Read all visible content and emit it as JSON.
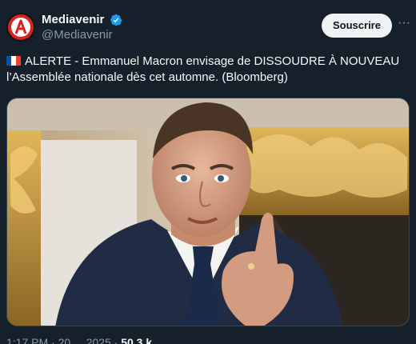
{
  "author": {
    "display_name": "Mediavenir",
    "handle": "@Mediavenir",
    "verified": true
  },
  "actions": {
    "subscribe_label": "Souscrire",
    "more_label": "···"
  },
  "tweet": {
    "flag_icon": "france-flag-icon",
    "text": "ALERTE - Emmanuel Macron envisage de DISSOUDRE À NOUVEAU l’Assemblée nationale dès cet automne. (Bloomberg)"
  },
  "media": {
    "image_icon": "photo-of-man-gesturing-icon"
  },
  "footer": {
    "time_partial": "1:17 PM · 20 ... 2025 · ",
    "views_partial": "50,3 k"
  },
  "colors": {
    "background": "#15202b",
    "verified_blue": "#1d9bf0",
    "subscribe_bg": "#eff3f4"
  }
}
